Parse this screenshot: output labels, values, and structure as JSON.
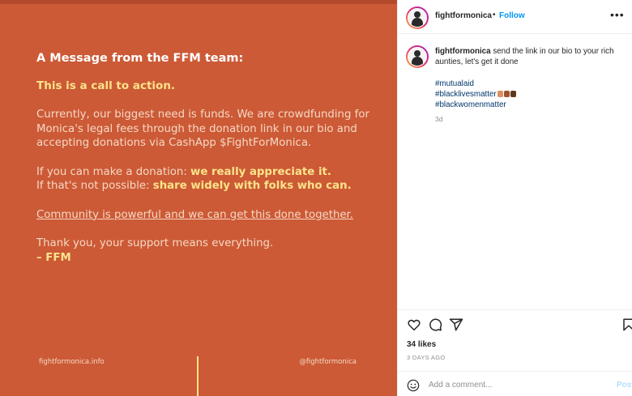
{
  "post_image": {
    "heading": "A Message from the FFM team:",
    "call_to_action": "This is a call to action.",
    "paragraph_1": "Currently, our biggest need is funds. We are crowdfunding for Monica's legal fees through the donation link in our bio and accepting donations via CashApp $FightForMonica.",
    "donate_prefix": "If you can make a donation: ",
    "donate_highlight": "we really appreciate it.",
    "share_prefix": "If that's not possible: ",
    "share_highlight": "share widely with folks who can.",
    "community_line": "Community is powerful and we can get this done together.",
    "thanks_line": "Thank you, your support means everything.",
    "signoff": "– FFM",
    "footer_left": "fightformonica.info",
    "footer_right": "@fightformonica",
    "background_color": "#cc5a36",
    "highlight_color": "#fce38a"
  },
  "header": {
    "username": "fightformonica",
    "separator": "•",
    "follow_label": "Follow",
    "more_icon": "more-horizontal-icon"
  },
  "caption": {
    "username": "fightformonica",
    "text": "send the link in our bio to your rich aunties, let's get it done",
    "hashtags": [
      "#mutualaid",
      "#blacklivesmatter",
      "#blackwomenmatter"
    ],
    "emoji_colors": [
      "#d9925f",
      "#a0522d",
      "#5c3a21"
    ],
    "time": "3d"
  },
  "actions": {
    "icons": [
      "heart-icon",
      "comment-icon",
      "share-icon",
      "bookmark-icon"
    ],
    "likes": "34 likes",
    "date": "3 DAYS AGO"
  },
  "comment": {
    "placeholder": "Add a comment...",
    "post_label": "Post",
    "emoji_icon": "smile-icon"
  },
  "colors": {
    "link_blue": "#0095f6",
    "hashtag_blue": "#00376b",
    "muted": "#8e8e8e"
  }
}
